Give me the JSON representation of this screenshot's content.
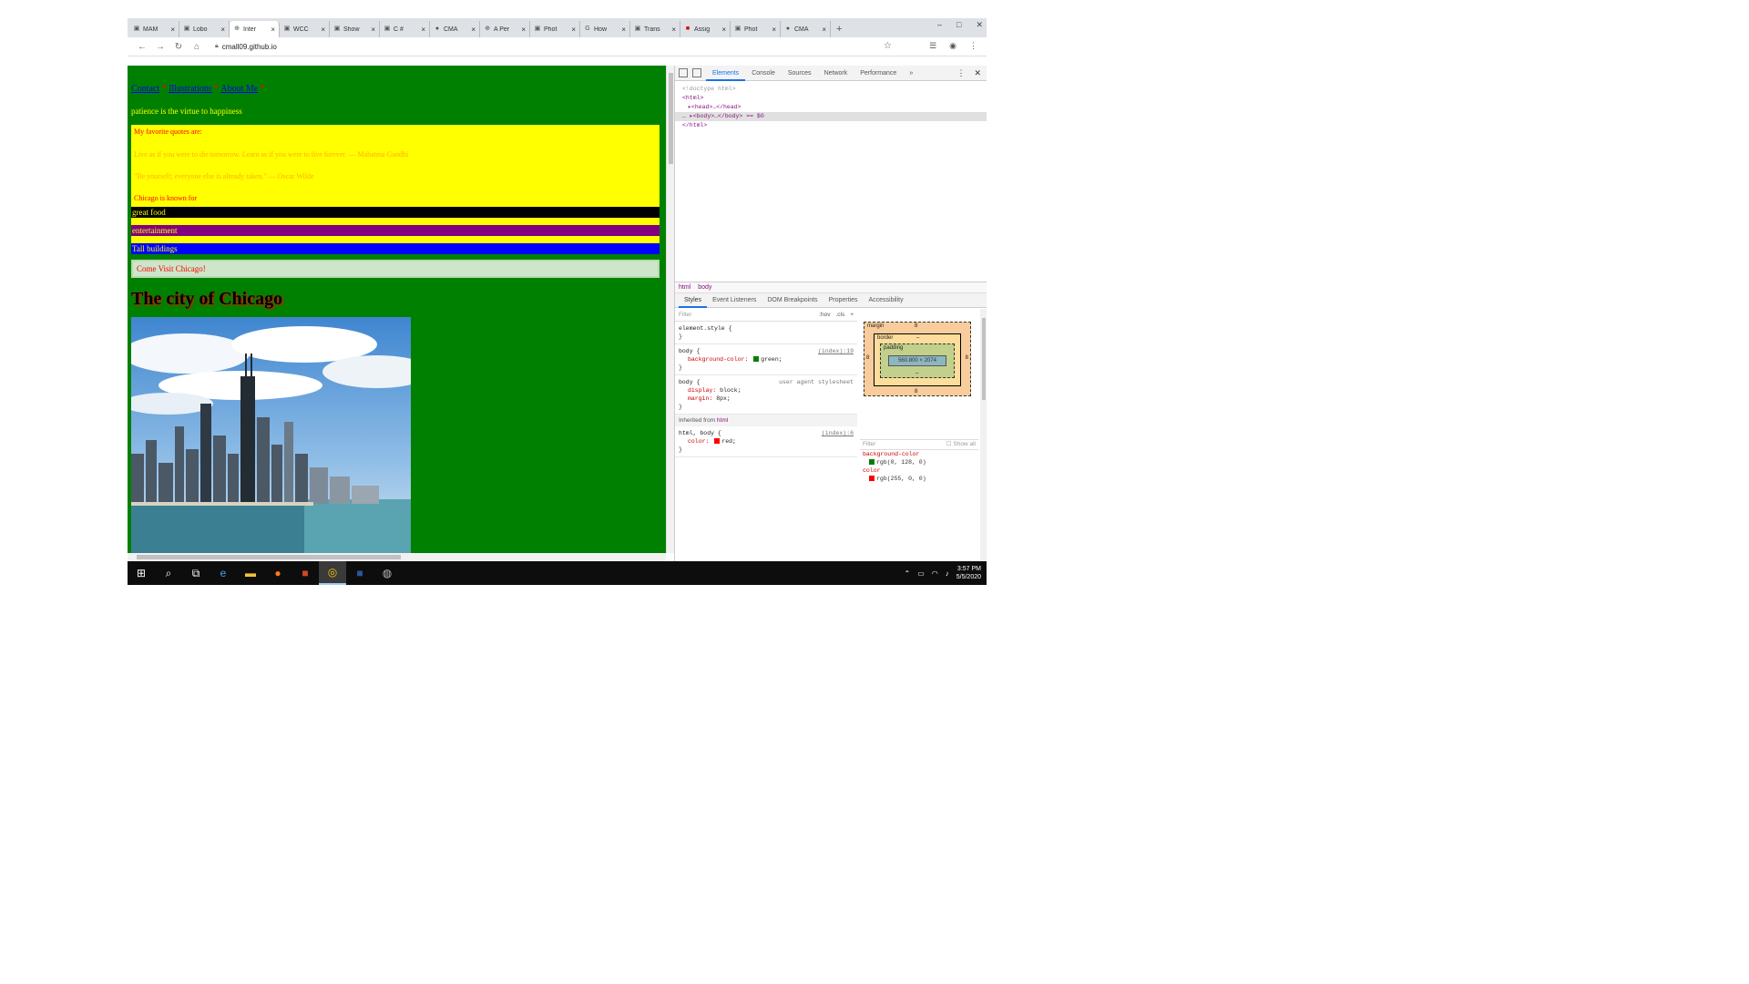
{
  "tabs": [
    {
      "label": "MAM",
      "icon": "page-icon",
      "active": false
    },
    {
      "label": "Lobo",
      "icon": "page-icon",
      "active": false
    },
    {
      "label": "Inter",
      "icon": "globe-icon",
      "active": true
    },
    {
      "label": "WCC",
      "icon": "page-icon",
      "active": false
    },
    {
      "label": "Show",
      "icon": "page-icon",
      "active": false
    },
    {
      "label": "C #",
      "icon": "page-icon",
      "active": false
    },
    {
      "label": "CMA",
      "icon": "github-icon",
      "active": false
    },
    {
      "label": "A Per",
      "icon": "globe-icon",
      "active": false
    },
    {
      "label": "Phot",
      "icon": "page-icon",
      "active": false
    },
    {
      "label": "How",
      "icon": "google-icon",
      "active": false
    },
    {
      "label": "Trans",
      "icon": "page-icon",
      "active": false
    },
    {
      "label": "Assig",
      "icon": "page-icon",
      "active": false
    },
    {
      "label": "Phot",
      "icon": "page-icon",
      "active": false
    },
    {
      "label": "CMA",
      "icon": "github-icon",
      "active": false
    }
  ],
  "browser": {
    "url": "cmall09.github.io",
    "new_tab": "+"
  },
  "page": {
    "nav": {
      "link1": "Contact",
      "sep1": " * ",
      "link2": "Illustrations",
      "sep2": " * ",
      "link3": "About Me",
      "sep3": " *"
    },
    "motto": "patience is the virtue to happiness",
    "yellow": {
      "favorite": "My favorite quotes are:",
      "quote1": "Live as if you were to die tomorrow. Learn as if you were to live forever. ― Mahatma Gandhi",
      "quote2": "\"Be yourself; everyone else is already taken.\" ― Oscar Wilde",
      "chicago": "Chicago is known for"
    },
    "stripes": [
      {
        "text": "great food",
        "bg": "#000000",
        "color": "#ffff00"
      },
      {
        "text": "",
        "bg": "#ffff00",
        "color": "#ffff00"
      },
      {
        "text": "entertainment",
        "bg": "#800080",
        "color": "#ffff00"
      },
      {
        "text": "",
        "bg": "#ffff00",
        "color": "#ffff00"
      },
      {
        "text": "Tall buildings",
        "bg": "#0000ff",
        "color": "#ffff00"
      }
    ],
    "visit": "Come Visit Chicago!",
    "city_heading": "The city of Chicago"
  },
  "devtools": {
    "tabs": [
      "Elements",
      "Console",
      "Sources",
      "Network",
      "Performance",
      "»"
    ],
    "dom": {
      "doctype": "<!doctype html>",
      "html": "<html>",
      "head": "▸<head>…</head>",
      "body": "… ▸<body>…</body> == $0",
      "html_close": "</html>"
    },
    "breadcrumbs": [
      "html",
      "body"
    ],
    "subtabs": [
      "Styles",
      "Event Listeners",
      "DOM Breakpoints",
      "Properties",
      "Accessibility"
    ],
    "filter": {
      "placeholder": "Filter",
      "hov": ":hov",
      "cls": ".cls",
      "plus": "+"
    },
    "rules": {
      "element_style": "element.style {",
      "element_close": "}",
      "body1_sel": "body {",
      "body1_src": "(index):19",
      "body1_prop": "background-color:",
      "body1_val": "green;",
      "body1_close": "}",
      "body2_sel": "body {",
      "body2_src": "user agent stylesheet",
      "body2_prop1": "display:",
      "body2_val1": "block;",
      "body2_prop2": "margin:",
      "body2_val2": "8px;",
      "body2_close": "}",
      "inherited_label": "Inherited from",
      "inherited_tag": "html",
      "html_sel": "html, body {",
      "html_src": "(index):6",
      "html_prop": "color:",
      "html_val": "red;",
      "html_close": "}"
    },
    "boxmodel": {
      "margin": "margin",
      "margin_val": "8",
      "border": "border",
      "border_val": "–",
      "padding": "padding",
      "padding_val": "–",
      "content": "560.800 × 2074",
      "side_left": "8",
      "side_right": "8",
      "bottom": "8"
    },
    "computed": {
      "filter": "Filter",
      "show_all": "Show all",
      "prop1": "background-color",
      "val1": "rgb(0, 128, 0)",
      "prop2": "color",
      "val2": "rgb(255, 0, 0)"
    }
  },
  "tray": {
    "time": "3:57 PM",
    "date": "5/5/2020"
  }
}
